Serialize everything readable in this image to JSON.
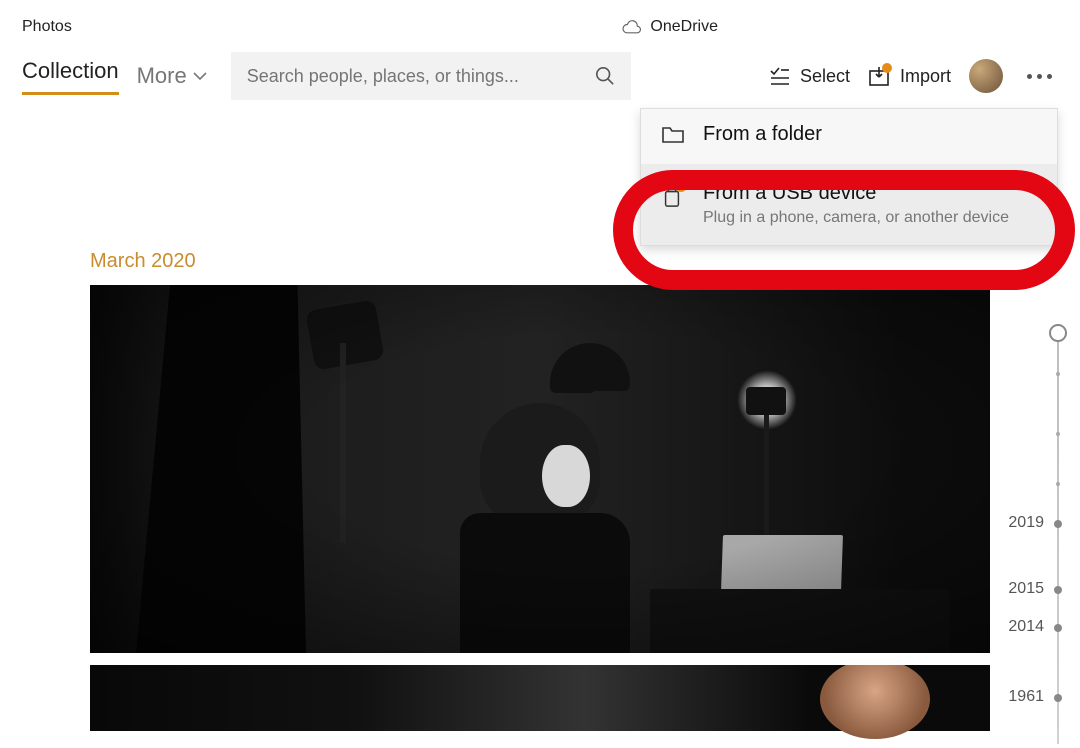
{
  "appTitle": "Photos",
  "onedrive": {
    "label": "OneDrive"
  },
  "tabs": {
    "active": "Collection",
    "more": "More"
  },
  "search": {
    "placeholder": "Search people, places, or things..."
  },
  "tools": {
    "select": "Select",
    "import": "Import"
  },
  "importMenu": {
    "folder": {
      "title": "From a folder"
    },
    "usb": {
      "title": "From a USB device",
      "subtitle": "Plug in a phone, camera, or another device"
    }
  },
  "content": {
    "dateHeading": "March 2020"
  },
  "timeline": {
    "years": [
      "2019",
      "2015",
      "2014",
      "1961"
    ]
  },
  "colors": {
    "accent": "#c88d2d",
    "badge": "#e38c1a",
    "highlight": "#e30613"
  }
}
